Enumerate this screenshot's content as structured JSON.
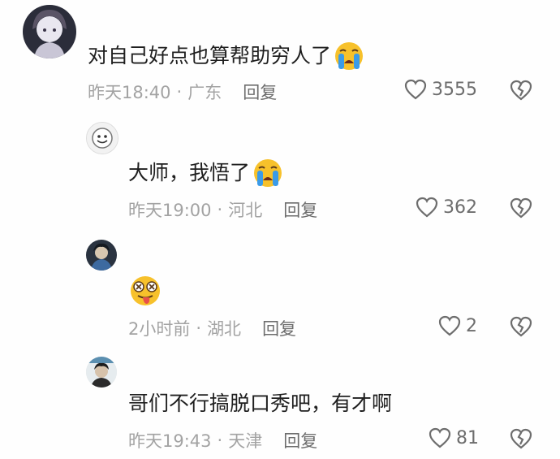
{
  "comments": [
    {
      "text": "对自己好点也算帮助穷人了",
      "emoji": "crying-face",
      "time": "昨天18:40",
      "location": "广东",
      "reply_label": "回复",
      "likes": "3555"
    },
    {
      "text": "大师，我悟了",
      "emoji": "crying-face",
      "time": "昨天19:00",
      "location": "河北",
      "reply_label": "回复",
      "likes": "362"
    },
    {
      "text": "",
      "emoji": "dizzy-tongue-face",
      "time": "2小时前",
      "location": "湖北",
      "reply_label": "回复",
      "likes": "2"
    },
    {
      "text": "哥们不行搞脱口秀吧，有才啊",
      "emoji": "",
      "time": "昨天19:43",
      "location": "天津",
      "reply_label": "回复",
      "likes": "81"
    }
  ],
  "separator": "·",
  "colors": {
    "meta": "#a3a3a3",
    "reply": "#6d6d6d",
    "text": "#1f1f1f",
    "emoji_yellow": "#f7c12b",
    "tear_blue": "#3b9be8"
  }
}
